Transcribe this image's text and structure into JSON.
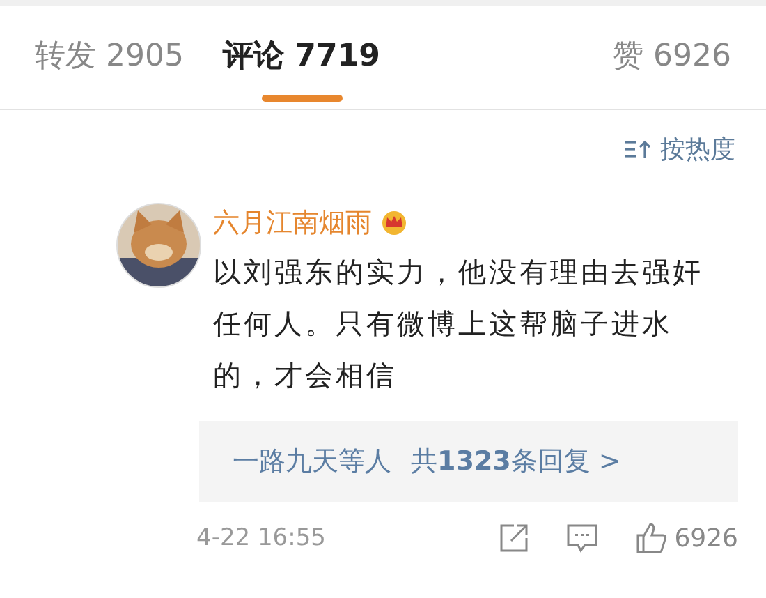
{
  "tabs": [
    {
      "label": "转发",
      "count": "2905",
      "selected": false
    },
    {
      "label": "评论",
      "count": "7719",
      "selected": true
    },
    {
      "label": "赞",
      "count": "6926",
      "selected": false
    }
  ],
  "sort": {
    "label": "按热度"
  },
  "comment": {
    "author": "六月江南烟雨",
    "vip": true,
    "text": "以刘强东的实力，他没有理由去强奸任何人。只有微博上这帮脑子进水的，才会相信",
    "replies": {
      "authors": "一路九天等人",
      "count": "共**1323**条回复 >"
    },
    "time": "4-22 16:55",
    "likes": "6926"
  }
}
